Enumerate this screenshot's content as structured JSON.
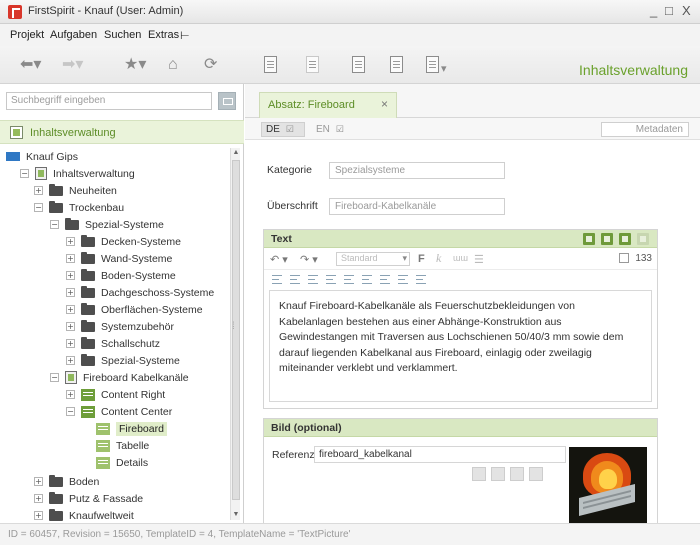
{
  "window": {
    "title": "FirstSpirit - Knauf (User: Admin)",
    "controls": [
      "_",
      "□",
      "X"
    ]
  },
  "menu": [
    "Projekt",
    "Aufgaben",
    "Suchen",
    "Extras",
    "⊢"
  ],
  "toolbar": {
    "area_label": "Inhaltsverwaltung",
    "icons": [
      "back-icon",
      "forward-icon",
      "bookmark-star-icon",
      "home-icon",
      "refresh-icon",
      "document-icon",
      "document-disabled-icon",
      "layers-icon",
      "document-add-icon",
      "document-action-icon"
    ]
  },
  "sidebar": {
    "search_placeholder": "Suchbegriff eingeben",
    "header": "Inhaltsverwaltung",
    "tree": [
      {
        "label": "Knauf Gips",
        "toggle": "",
        "icon": "root"
      },
      {
        "label": "Inhaltsverwaltung",
        "toggle": "−",
        "icon": "page"
      },
      {
        "label": "Neuheiten",
        "toggle": "+",
        "icon": "folder"
      },
      {
        "label": "Trockenbau",
        "toggle": "−",
        "icon": "folder"
      },
      {
        "label": "Spezial-Systeme",
        "toggle": "−",
        "icon": "folder"
      },
      {
        "label": "Decken-Systeme",
        "toggle": "+",
        "icon": "folder"
      },
      {
        "label": "Wand-Systeme",
        "toggle": "+",
        "icon": "folder"
      },
      {
        "label": "Boden-Systeme",
        "toggle": "+",
        "icon": "folder"
      },
      {
        "label": "Dachgeschoss-Systeme",
        "toggle": "+",
        "icon": "folder"
      },
      {
        "label": "Oberflächen-Systeme",
        "toggle": "+",
        "icon": "folder"
      },
      {
        "label": "Systemzubehör",
        "toggle": "+",
        "icon": "folder"
      },
      {
        "label": "Schallschutz",
        "toggle": "+",
        "icon": "folder"
      },
      {
        "label": "Spezial-Systeme",
        "toggle": "+",
        "icon": "folder"
      },
      {
        "label": "Fireboard Kabelkanäle",
        "toggle": "−",
        "icon": "page"
      },
      {
        "label": "Content Right",
        "toggle": "+",
        "icon": "section"
      },
      {
        "label": "Content Center",
        "toggle": "−",
        "icon": "section"
      },
      {
        "label": "Fireboard",
        "toggle": "",
        "icon": "section-light"
      },
      {
        "label": "Tabelle",
        "toggle": "",
        "icon": "section-light"
      },
      {
        "label": "Details",
        "toggle": "",
        "icon": "section-light"
      },
      {
        "label": "Boden",
        "toggle": "+",
        "icon": "folder"
      },
      {
        "label": "Putz & Fassade",
        "toggle": "+",
        "icon": "folder"
      },
      {
        "label": "Knaufweltweit",
        "toggle": "+",
        "icon": "folder"
      }
    ],
    "selected": "Fireboard"
  },
  "editor": {
    "tab_label": "Absatz: Fireboard",
    "tab_close": "×",
    "languages": [
      {
        "code": "DE",
        "active": true
      },
      {
        "code": "EN",
        "active": false
      }
    ],
    "metadata_label": "Metadaten",
    "kategorie": {
      "label": "Kategorie",
      "value": "Spezialsysteme"
    },
    "ueberschrift": {
      "label": "Überschrift",
      "value": "Fireboard-Kabelkanäle"
    },
    "text_section": {
      "title": "Text",
      "style_select": "Standard",
      "bold_label": "F",
      "italic_label": "k",
      "char_count": "133",
      "body": "Knauf Fireboard-Kabelkanäle als Feuerschutzbekleidungen von Kabelanlagen bestehen aus einer Abhänge-Konstruktion aus Gewindestangen mit Traversen aus Lochschienen 50/40/3 mm sowie dem darauf liegenden Kabelkanal aus Fireboard, einlagig oder zweilagig miteinander verklebt und verklammert."
    },
    "bild_section": {
      "title": "Bild (optional)",
      "referenz_label": "Referenz",
      "referenz_value": "fireboard_kabelkanal"
    }
  },
  "status": {
    "text": "ID = 60457,  Revision = 15650,  TemplateID = 4,  TemplateName = 'TextPicture'"
  },
  "colors": {
    "accent_green": "#5d8d26",
    "header_green": "#d9e8c2",
    "brand_red": "#d8362a"
  }
}
